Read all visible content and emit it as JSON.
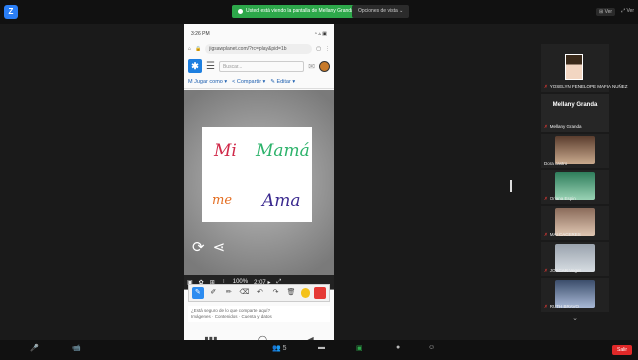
{
  "topbar": {
    "logo": "Z",
    "share_notice": "Usted está viendo la pantalla de Mellany Granda",
    "view_options": "Opciones de vista ⌄",
    "right_1": "⊞ Ver",
    "right_2": "⤢ Ver"
  },
  "phone": {
    "time": "3:26 PM",
    "status_icons": "◔ ▵ ▣",
    "url": "jigsawplanet.com/?rc=play&pid=1b",
    "search_placeholder": "Buscar...",
    "actions": [
      "M Jugar como ▾",
      "< Compartir ▾",
      "✎ Editar ▾"
    ],
    "words": [
      "Mi",
      "Mamá",
      "me",
      "Ama"
    ],
    "game_bar": {
      "percent": "100%",
      "timer": "2:07 ▸"
    },
    "notification": "¿Está seguro de lo que comparte aquí?",
    "notification_sub": "Imágenes · Contenidos · Cuenta y datos"
  },
  "participants": [
    {
      "name": "YOSELYN FENELOPE MAFIA NUÑEZ",
      "kind": "video"
    },
    {
      "name": "Mellany Granda",
      "kind": "name"
    },
    {
      "name": "Dora castro",
      "kind": "video"
    },
    {
      "name": "Oriana Espin",
      "kind": "video"
    },
    {
      "name": "MAI CACERES",
      "kind": "video"
    },
    {
      "name": "JOSCAR Veget",
      "kind": "video"
    },
    {
      "name": "RUTH BRAVO",
      "kind": "video"
    }
  ],
  "name_tile": {
    "title": "Mellany Granda",
    "sub": "Mellany Granda"
  },
  "bottombar": {
    "unmute": "🎤",
    "video": "📹",
    "participants": "👥 5",
    "leave": "Salir"
  }
}
